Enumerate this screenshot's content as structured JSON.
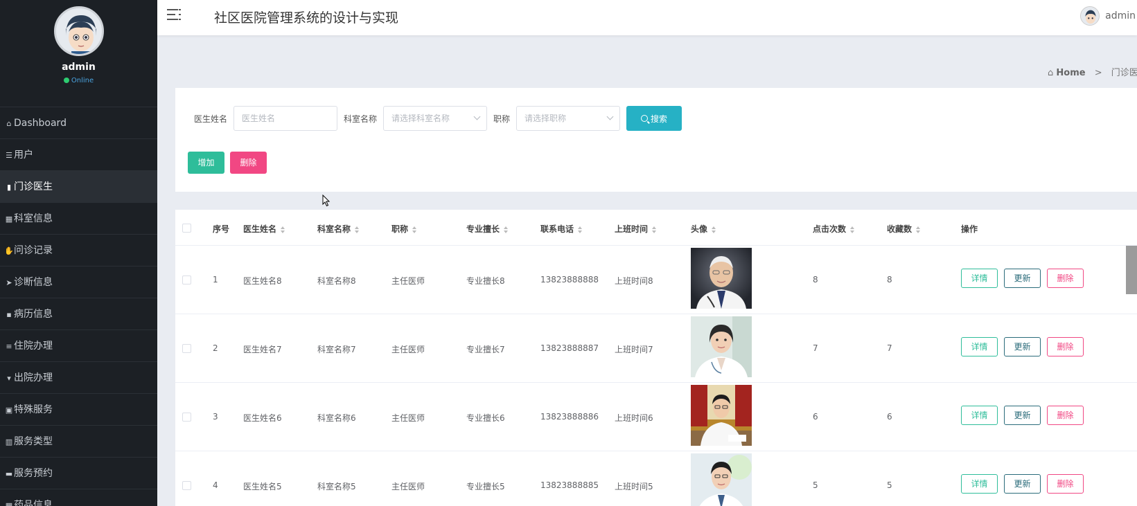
{
  "sidebar": {
    "username": "admin",
    "status": "Online",
    "items": [
      {
        "label": "Dashboard",
        "icon": "home-icon"
      },
      {
        "label": "用户",
        "icon": "sliders-icon"
      },
      {
        "label": "门诊医生",
        "icon": "book-icon",
        "active": true
      },
      {
        "label": "科室信息",
        "icon": "grid-icon"
      },
      {
        "label": "问诊记录",
        "icon": "hand-icon"
      },
      {
        "label": "诊断信息",
        "icon": "send-icon"
      },
      {
        "label": "病历信息",
        "icon": "apps-icon"
      },
      {
        "label": "住院办理",
        "icon": "list-icon"
      },
      {
        "label": "出院办理",
        "icon": "thumb-down-icon"
      },
      {
        "label": "特殊服务",
        "icon": "briefcase-icon"
      },
      {
        "label": "服务类型",
        "icon": "bar-chart-icon"
      },
      {
        "label": "服务预约",
        "icon": "comment-icon"
      },
      {
        "label": "药品信息",
        "icon": "grid-icon"
      }
    ]
  },
  "header": {
    "title": "社区医院管理系统的设计与实现",
    "username": "admin"
  },
  "breadcrumb": {
    "home": "Home",
    "separator": ">",
    "current": "门诊医生"
  },
  "search": {
    "doctor_name_label": "医生姓名",
    "doctor_name_placeholder": "医生姓名",
    "dept_label": "科室名称",
    "dept_placeholder": "请选择科室名称",
    "title_label": "职称",
    "title_placeholder": "请选择职称",
    "search_button": "搜索"
  },
  "actions": {
    "add": "增加",
    "delete": "删除"
  },
  "table": {
    "columns": [
      "序号",
      "医生姓名",
      "科室名称",
      "职称",
      "专业擅长",
      "联系电话",
      "上班时间",
      "头像",
      "点击次数",
      "收藏数",
      "操作"
    ],
    "row_buttons": {
      "detail": "详情",
      "update": "更新",
      "delete": "删除"
    },
    "rows": [
      {
        "index": "1",
        "name": "医生姓名8",
        "dept": "科室名称8",
        "title": "主任医师",
        "specialty": "专业擅长8",
        "phone": "13823888888",
        "work_time": "上班时间8",
        "clicks": "8",
        "favorites": "8"
      },
      {
        "index": "2",
        "name": "医生姓名7",
        "dept": "科室名称7",
        "title": "主任医师",
        "specialty": "专业擅长7",
        "phone": "13823888887",
        "work_time": "上班时间7",
        "clicks": "7",
        "favorites": "7"
      },
      {
        "index": "3",
        "name": "医生姓名6",
        "dept": "科室名称6",
        "title": "主任医师",
        "specialty": "专业擅长6",
        "phone": "13823888886",
        "work_time": "上班时间6",
        "clicks": "6",
        "favorites": "6"
      },
      {
        "index": "4",
        "name": "医生姓名5",
        "dept": "科室名称5",
        "title": "主任医师",
        "specialty": "专业擅长5",
        "phone": "13823888885",
        "work_time": "上班时间5",
        "clicks": "5",
        "favorites": "5"
      }
    ]
  },
  "colors": {
    "sidebar_bg": "#1c2025",
    "search_btn": "#26b1c5",
    "add_btn": "#2ebd9a",
    "delete_btn": "#f14783",
    "update_btn": "#2a6b7a"
  }
}
